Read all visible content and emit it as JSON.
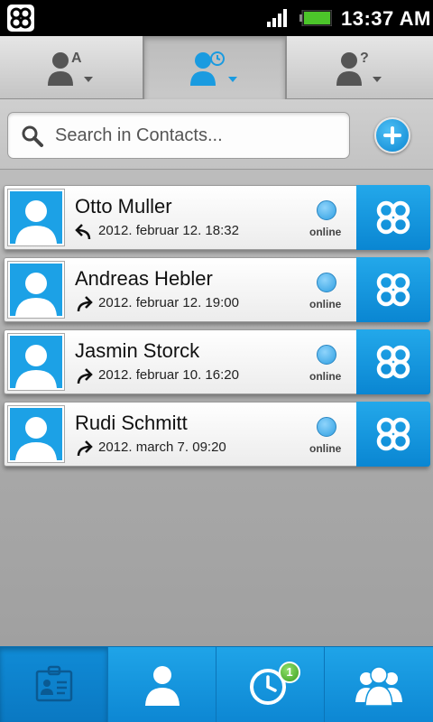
{
  "status_bar": {
    "time": "13:37 AM"
  },
  "search": {
    "placeholder": "Search in Contacts..."
  },
  "colors": {
    "accent": "#0a86d2",
    "online": "#2f9fe2",
    "badge": "#3b9e1f"
  },
  "top_tabs": [
    {
      "icon": "person-alphabetical-icon",
      "active": false
    },
    {
      "icon": "person-recent-icon",
      "active": true
    },
    {
      "icon": "person-unknown-icon",
      "active": false
    }
  ],
  "contacts": [
    {
      "name": "Otto Muller",
      "time": "2012. februar 12. 18:32",
      "direction": "incoming",
      "status": "online"
    },
    {
      "name": "Andreas Hebler",
      "time": "2012. februar 12. 19:00",
      "direction": "outgoing",
      "status": "online"
    },
    {
      "name": "Jasmin Storck",
      "time": "2012. februar 10. 16:20",
      "direction": "outgoing",
      "status": "online"
    },
    {
      "name": "Rudi Schmitt",
      "time": "2012. march 7. 09:20",
      "direction": "outgoing",
      "status": "online"
    }
  ],
  "bottom_tabs": [
    {
      "icon": "contact-card-icon",
      "active": true
    },
    {
      "icon": "person-icon",
      "active": false
    },
    {
      "icon": "clock-icon",
      "active": false,
      "badge": "1"
    },
    {
      "icon": "group-icon",
      "active": false
    }
  ]
}
